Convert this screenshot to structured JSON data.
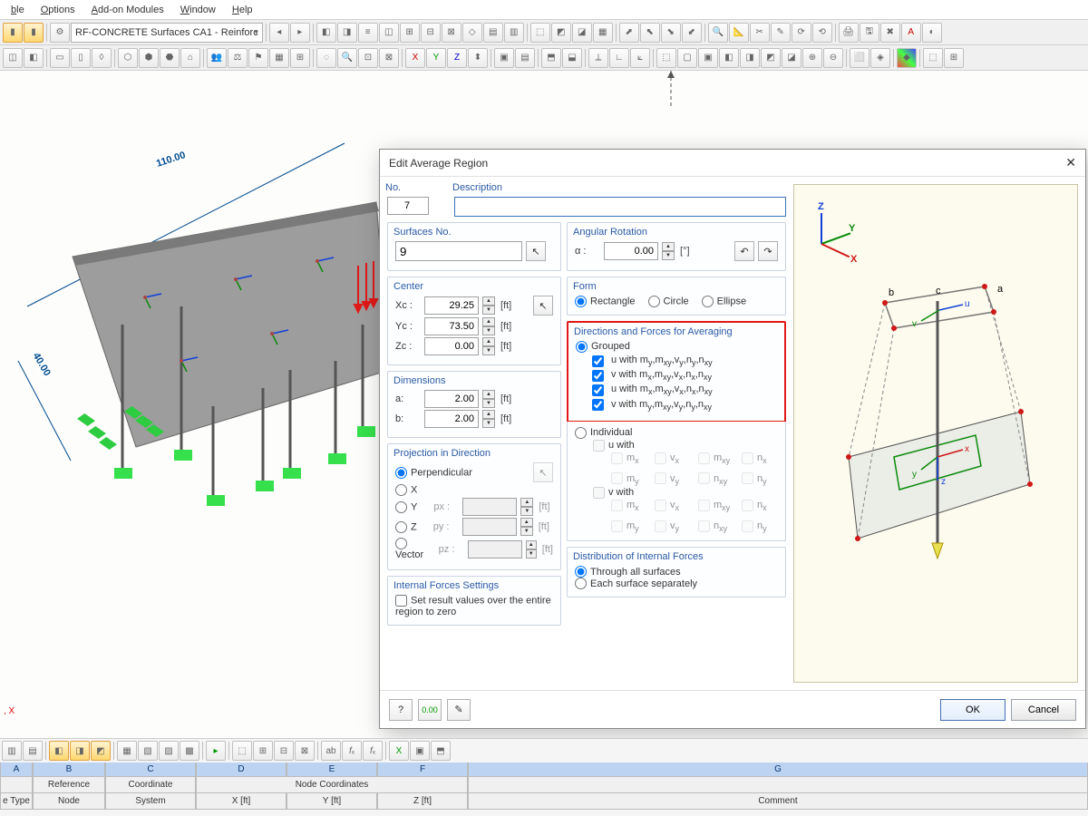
{
  "menu": {
    "items": [
      "ble",
      "Options",
      "Add-on Modules",
      "Window",
      "Help"
    ]
  },
  "toolbar": {
    "dropdown": "RF-CONCRETE Surfaces CA1 - Reinforc"
  },
  "canvas": {
    "dim_long": "110.00",
    "dim_short": "40.00",
    "axes_caption": ", X"
  },
  "dialog": {
    "title": "Edit Average Region",
    "labels": {
      "no": "No.",
      "description": "Description",
      "surfaces_no": "Surfaces No.",
      "angular_rotation": "Angular Rotation",
      "alpha": "α :",
      "center": "Center",
      "xc": "Xc :",
      "yc": "Yc :",
      "zc": "Zc :",
      "form": "Form",
      "rectangle": "Rectangle",
      "circle": "Circle",
      "ellipse": "Ellipse",
      "directions": "Directions and Forces for Averaging",
      "grouped": "Grouped",
      "individual": "Individual",
      "u_with": "u with",
      "v_with": "v with",
      "dimensions": "Dimensions",
      "a": "a:",
      "b": "b:",
      "projection": "Projection in Direction",
      "perpendicular": "Perpendicular",
      "axis_x": "X",
      "axis_y": "Y",
      "axis_z": "Z",
      "vector": "Vector",
      "px": "px :",
      "py": "py :",
      "pz": "pz :",
      "internal_forces": "Internal Forces Settings",
      "set_zero": "Set result values over the entire region to zero",
      "distribution": "Distribution of Internal Forces",
      "through_all": "Through all surfaces",
      "each_separately": "Each surface separately",
      "ft": "[ft]",
      "deg": "[°]"
    },
    "values": {
      "no": "7",
      "description": "",
      "surfaces_no": "9",
      "alpha": "0.00",
      "xc": "29.25",
      "yc": "73.50",
      "zc": "0.00",
      "a": "2.00",
      "b": "2.00"
    },
    "grouped_items": [
      "u with m<sub>y</sub>,m<sub>xy</sub>,v<sub>y</sub>,n<sub>y</sub>,n<sub>xy</sub>",
      "v with m<sub>x</sub>,m<sub>xy</sub>,v<sub>x</sub>,n<sub>x</sub>,n<sub>xy</sub>",
      "u with m<sub>x</sub>,m<sub>xy</sub>,v<sub>x</sub>,n<sub>x</sub>,n<sub>xy</sub>",
      "v with m<sub>y</sub>,m<sub>xy</sub>,v<sub>y</sub>,n<sub>y</sub>,n<sub>xy</sub>"
    ],
    "individual_labels": {
      "mx": "m<sub>x</sub>",
      "vx": "v<sub>x</sub>",
      "mxy": "m<sub>xy</sub>",
      "nx": "n<sub>x</sub>",
      "my": "m<sub>y</sub>",
      "vy": "v<sub>y</sub>",
      "nxy": "n<sub>xy</sub>",
      "ny": "n<sub>y</sub>"
    },
    "buttons": {
      "ok": "OK",
      "cancel": "Cancel"
    }
  },
  "preview": {
    "axes": {
      "z": "Z",
      "x": "X",
      "y": "Y"
    },
    "corners": {
      "a": "a",
      "b": "b",
      "c": "c"
    },
    "local": {
      "u": "u",
      "v": "v",
      "x": "x",
      "y": "y",
      "z": "z"
    }
  },
  "grid": {
    "letters": [
      "A",
      "B",
      "C",
      "D",
      "E",
      "F",
      "G"
    ],
    "row1": [
      "",
      "Reference",
      "Coordinate",
      "Node Coordinates",
      "",
      ""
    ],
    "row2": [
      "e Type",
      "Node",
      "System",
      "X [ft]",
      "Y [ft]",
      "Z [ft]",
      "Comment"
    ]
  }
}
